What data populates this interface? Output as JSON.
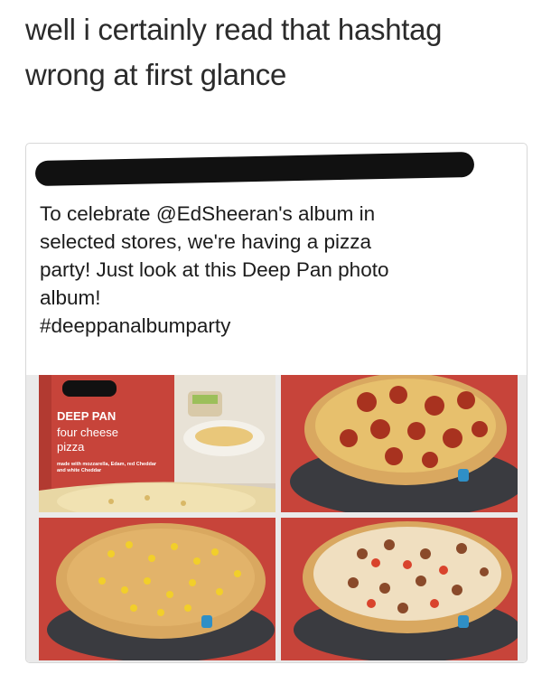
{
  "caption": {
    "line1": "well i certainly read that hashtag",
    "line2": "wrong at first glance"
  },
  "post": {
    "line1": "To celebrate @EdSheeran's album in",
    "line2": "selected stores, we're having a pizza",
    "line3": "party! Just look at this Deep Pan photo",
    "line4": "album!",
    "hashtag": "#deeppanalbumparty"
  },
  "photos": {
    "box": {
      "title": "DEEP PAN",
      "subtitle_1": "four cheese",
      "subtitle_2": "pizza",
      "small_1": "made with mozzarella, Edam, red Cheddar",
      "small_2": "and white Cheddar"
    }
  },
  "colors": {
    "box_red": "#c7443a",
    "crust": "#d9a860",
    "pepperoni": "#a8321f",
    "plate": "#3a3b40"
  }
}
